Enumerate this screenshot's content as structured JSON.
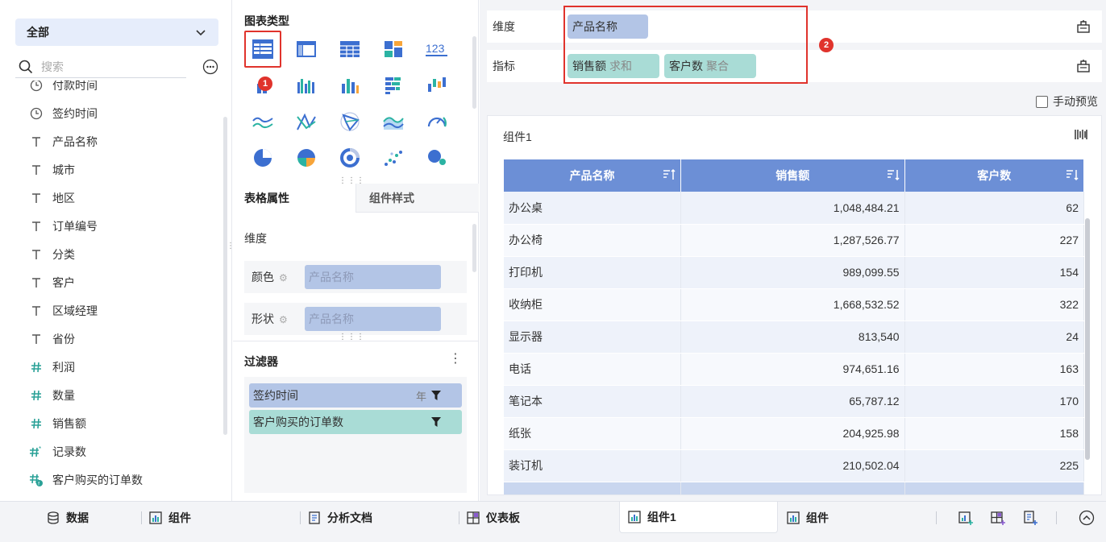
{
  "left": {
    "scope": "全部",
    "search_placeholder": "搜索",
    "fields": [
      {
        "icon": "clock",
        "label": "付款时间"
      },
      {
        "icon": "clock",
        "label": "签约时间"
      },
      {
        "icon": "text",
        "label": "产品名称"
      },
      {
        "icon": "text",
        "label": "城市"
      },
      {
        "icon": "text",
        "label": "地区"
      },
      {
        "icon": "text",
        "label": "订单编号"
      },
      {
        "icon": "text",
        "label": "分类"
      },
      {
        "icon": "text",
        "label": "客户"
      },
      {
        "icon": "text",
        "label": "区域经理"
      },
      {
        "icon": "text",
        "label": "省份"
      },
      {
        "icon": "hash",
        "label": "利润"
      },
      {
        "icon": "hash",
        "label": "数量"
      },
      {
        "icon": "hash",
        "label": "销售额"
      },
      {
        "icon": "hash-star",
        "label": "记录数"
      },
      {
        "icon": "hash-calc",
        "label": "客户购买的订单数"
      }
    ]
  },
  "mid": {
    "chart_type_title": "图表类型",
    "badge1": "1",
    "tabs": {
      "props": "表格属性",
      "style": "组件样式"
    },
    "dimension_label": "维度",
    "color_label": "颜色",
    "color_value": "产品名称",
    "shape_label": "形状",
    "shape_value": "产品名称",
    "filter_title": "过滤器",
    "filters": [
      {
        "label": "签约时间",
        "extra": "年"
      },
      {
        "label": "客户购买的订单数",
        "extra": ""
      }
    ]
  },
  "right": {
    "dimension_label": "维度",
    "dimension_pill": "产品名称",
    "measure_label": "指标",
    "measure_pills": [
      {
        "name": "销售额",
        "agg": "求和"
      },
      {
        "name": "客户数",
        "agg": "聚合"
      }
    ],
    "badge2": "2",
    "manual_preview": "手动预览",
    "widget_title": "组件1",
    "table": {
      "columns": [
        "产品名称",
        "销售额",
        "客户数"
      ],
      "rows": [
        [
          "办公桌",
          "1,048,484.21",
          "62"
        ],
        [
          "办公椅",
          "1,287,526.77",
          "227"
        ],
        [
          "打印机",
          "989,099.55",
          "154"
        ],
        [
          "收纳柜",
          "1,668,532.52",
          "322"
        ],
        [
          "显示器",
          "813,540",
          "24"
        ],
        [
          "电话",
          "974,651.16",
          "163"
        ],
        [
          "笔记本",
          "65,787.12",
          "170"
        ],
        [
          "纸张",
          "204,925.98",
          "158"
        ],
        [
          "装订机",
          "210,502.04",
          "225"
        ]
      ]
    }
  },
  "tabbar": {
    "data": "数据",
    "widget_a": "组件",
    "doc": "分析文档",
    "dashboard": "仪表板",
    "widget1": "组件1",
    "widget_b": "组件"
  },
  "colors": {
    "accent": "#6c8fd6",
    "dim_pill": "#b3c5e6",
    "measure_pill": "#a9dcd6",
    "annotation": "#e0332c"
  }
}
